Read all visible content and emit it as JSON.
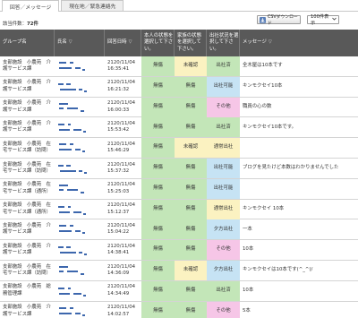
{
  "tabs": [
    {
      "label": "回答／メッセージ",
      "active": true
    },
    {
      "label": "現在地／緊急連絡先",
      "active": false
    }
  ],
  "summary": {
    "label": "該当件数：",
    "count": "72件"
  },
  "toolbar": {
    "csv_label": "CSVダウンロード",
    "per_page": "100件表示"
  },
  "columns": {
    "group": "グループ名",
    "name": "氏名",
    "date": "回答日時",
    "self": "本人の状態を選択して下さい。",
    "family": "家族の状態を選択して下さい。",
    "work": "出社状況を選択して下さい。",
    "message": "メッセージ"
  },
  "colors": {
    "header_bg": "#595959",
    "green": "#c3e6b8",
    "yellow": "#fbf2c1",
    "pink": "#f6c6e7",
    "blue": "#c6e3f4",
    "redacted_name": "#3d67ad"
  },
  "rows": [
    {
      "group": "支部施設　小農苑　介護サービス課",
      "date": "2120/11/04 16:35:41",
      "self": "無傷",
      "family": "未確認",
      "work": "出社済",
      "message": "全木屋は10本です"
    },
    {
      "group": "支部施設　小農苑　介護サービス課",
      "date": "2120/11/04 16:21:32",
      "self": "無傷",
      "family": "無傷",
      "work": "出社可能",
      "message": "キンモクセイ10本"
    },
    {
      "group": "支部施設　小農苑　介護サービス課",
      "date": "2120/11/04 16:00:33",
      "self": "無傷",
      "family": "無傷",
      "work": "その他",
      "message": "職員の心の数"
    },
    {
      "group": "支部施設　小農苑　介護サービス課",
      "date": "2120/11/04 15:53:42",
      "self": "無傷",
      "family": "無傷",
      "work": "出社済",
      "message": "キンモクセイ10本です。"
    },
    {
      "group": "支部施設　小農苑　在宅サービス課（訪問）",
      "date": "2120/11/04 15:46:29",
      "self": "無傷",
      "family": "未確認",
      "work": "通常出社",
      "message": ""
    },
    {
      "group": "支部施設　小農苑　在宅サービス課（訪問）",
      "date": "2120/11/04 15:37:32",
      "self": "無傷",
      "family": "無傷",
      "work": "出社可能",
      "message": "ブログを見たけど本数はわかりませんでした"
    },
    {
      "group": "支部施設　小農苑　在宅サービス課（通所）",
      "date": "2120/11/04 15:25:03",
      "self": "無傷",
      "family": "無傷",
      "work": "出社可能",
      "message": ""
    },
    {
      "group": "支部施設　小農苑　在宅サービス課（通所）",
      "date": "2120/11/04 15:12:37",
      "self": "無傷",
      "family": "無傷",
      "work": "通常出社",
      "message": "キンモクセイ 10本"
    },
    {
      "group": "支部施設　小農苑　介護サービス課",
      "date": "2120/11/04 15:04:22",
      "self": "無傷",
      "family": "無傷",
      "work": "夕方出社",
      "message": "一本"
    },
    {
      "group": "支部施設　小農苑　介護サービス課",
      "date": "2120/11/04 14:38:41",
      "self": "無傷",
      "family": "無傷",
      "work": "その他",
      "message": "10本"
    },
    {
      "group": "支部施設　小農苑　在宅サービス課（訪問）",
      "date": "2120/11/04 14:36:09",
      "self": "無傷",
      "family": "未確認",
      "work": "夕方出社",
      "message": "キンモクセイは10本です(^_^)/"
    },
    {
      "group": "支部施設　小農苑　総務管理課",
      "date": "2120/11/04 14:34:49",
      "self": "無傷",
      "family": "無傷",
      "work": "出社済",
      "message": "10本"
    },
    {
      "group": "支部施設　小農苑　介護サービス課",
      "date": "2120/11/04 14:02:57",
      "self": "無傷",
      "family": "無傷",
      "work": "その他",
      "message": "5本"
    }
  ]
}
